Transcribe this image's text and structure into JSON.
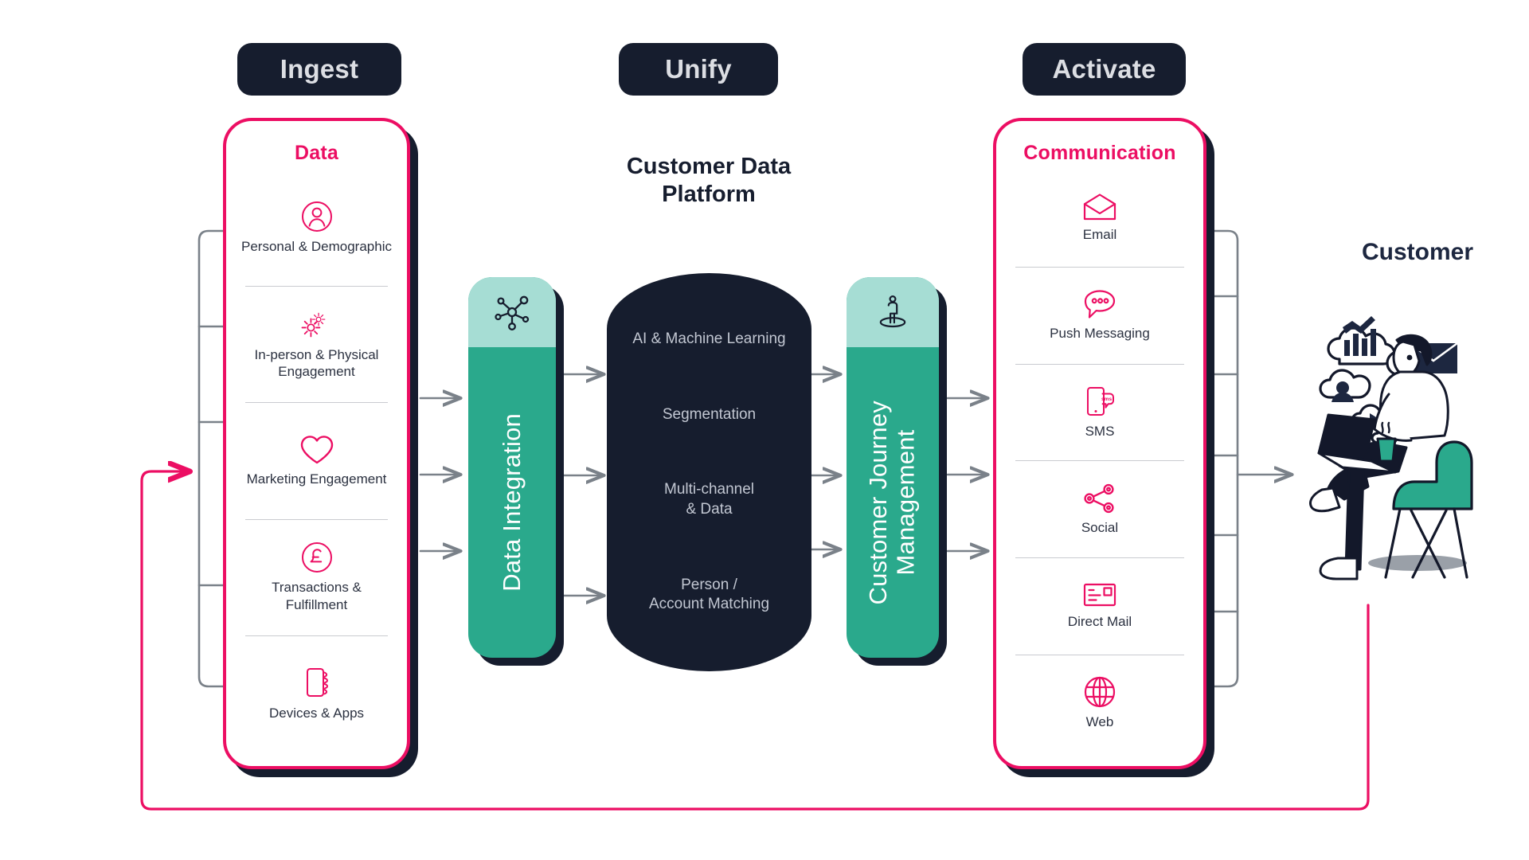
{
  "stages": {
    "ingest": "Ingest",
    "unify": "Unify",
    "activate": "Activate"
  },
  "data_panel": {
    "title": "Data",
    "items": [
      {
        "icon": "person-circle-icon",
        "label": "Personal\n& Demographic"
      },
      {
        "icon": "gears-icon",
        "label": "In-person & Physical\nEngagement"
      },
      {
        "icon": "heart-icon",
        "label": "Marketing\nEngagement"
      },
      {
        "icon": "pound-circle-icon",
        "label": "Transactions &\nFulfillment"
      },
      {
        "icon": "devices-apps-icon",
        "label": "Devices & Apps"
      }
    ]
  },
  "data_integration": {
    "label": "Data Integration",
    "icon": "network-nodes-icon"
  },
  "cdp": {
    "title": "Customer Data\nPlatform",
    "items": [
      "AI & Machine Learning",
      "Segmentation",
      "Multi-channel\n& Data",
      "Person /\nAccount Matching"
    ]
  },
  "journey": {
    "label": "Customer Journey\nManagement",
    "icon": "person-spotlight-icon"
  },
  "communication_panel": {
    "title": "Communication",
    "items": [
      {
        "icon": "envelope-open-icon",
        "label": "Email"
      },
      {
        "icon": "chat-bubble-dots-icon",
        "label": "Push Messaging"
      },
      {
        "icon": "sms-phone-icon",
        "label": "SMS"
      },
      {
        "icon": "share-nodes-icon",
        "label": "Social"
      },
      {
        "icon": "direct-mail-icon",
        "label": "Direct Mail"
      },
      {
        "icon": "globe-icon",
        "label": "Web"
      }
    ]
  },
  "customer": {
    "title": "Customer",
    "illustration": "person-in-chair-with-laptop-illustration"
  },
  "colors": {
    "accent_pink": "#ec0e63",
    "dark_navy": "#161d2e",
    "teal": "#2aa98c",
    "teal_light": "#a6ddd4",
    "connector_grey": "#7a8189",
    "text_dark": "#2b3140"
  }
}
